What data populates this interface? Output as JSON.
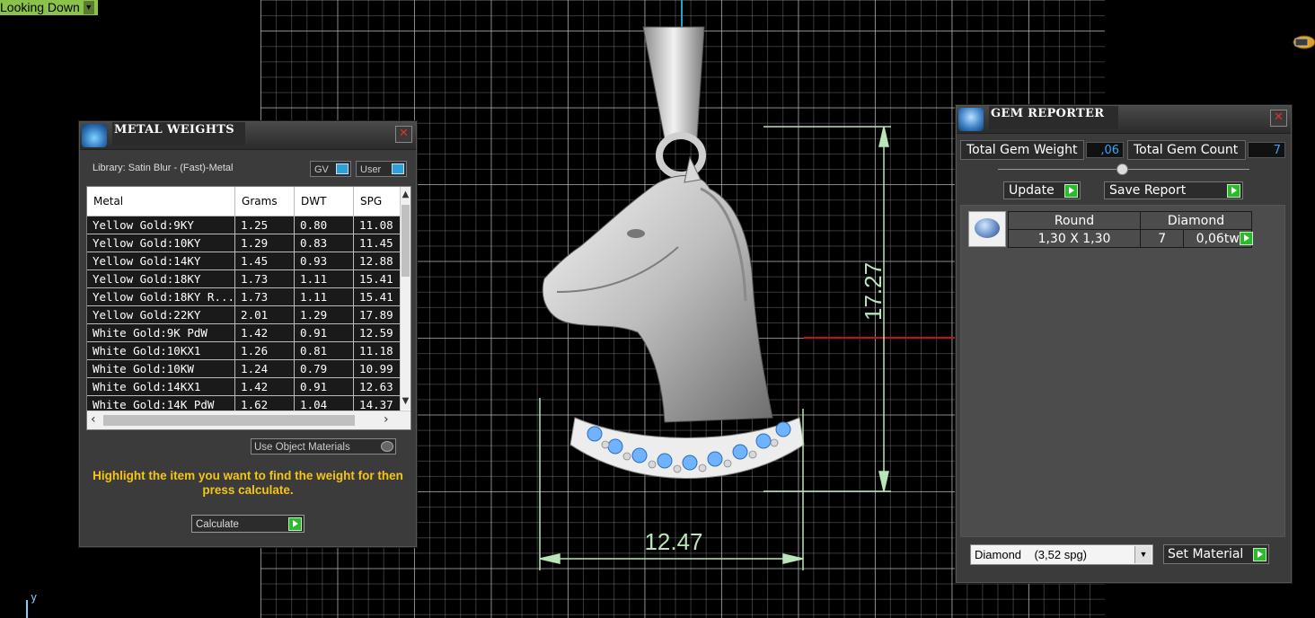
{
  "viewport": {
    "view_name": "Looking Down",
    "dimension_height": "17.27",
    "dimension_width": "12.47",
    "axis_label": "y",
    "colors": {
      "grid": "#808080",
      "dimension": "#b8e6b8",
      "x_axis": "#c0141a",
      "y_axis": "#1aa7c8"
    }
  },
  "metal_panel": {
    "title": "METAL WEIGHTS",
    "library": "Library: Satin Blur - (Fast)-Metal",
    "toggle_gv": "GV",
    "toggle_user": "User",
    "columns": [
      "Metal",
      "Grams",
      "DWT",
      "SPG"
    ],
    "rows": [
      [
        "Yellow Gold:9KY",
        "1.25",
        "0.80",
        "11.08"
      ],
      [
        "Yellow Gold:10KY",
        "1.29",
        "0.83",
        "11.45"
      ],
      [
        "Yellow Gold:14KY",
        "1.45",
        "0.93",
        "12.88"
      ],
      [
        "Yellow Gold:18KY",
        "1.73",
        "1.11",
        "15.41"
      ],
      [
        "Yellow Gold:18KY R...",
        "1.73",
        "1.11",
        "15.41"
      ],
      [
        "Yellow Gold:22KY",
        "2.01",
        "1.29",
        "17.89"
      ],
      [
        "White Gold:9K PdW",
        "1.42",
        "0.91",
        "12.59"
      ],
      [
        "White Gold:10KX1",
        "1.26",
        "0.81",
        "11.18"
      ],
      [
        "White Gold:10KW",
        "1.24",
        "0.79",
        "10.99"
      ],
      [
        "White Gold:14KX1",
        "1.42",
        "0.91",
        "12.63"
      ],
      [
        "White Gold:14K PdW",
        "1.62",
        "1.04",
        "14.37"
      ]
    ],
    "use_object_materials": "Use Object Materials",
    "hint": "Highlight the item you want to find the weight for then press calculate.",
    "calculate_label": "Calculate"
  },
  "gem_panel": {
    "title": "GEM REPORTER",
    "total_weight_label": "Total Gem Weight",
    "total_weight_value": ",06",
    "total_count_label": "Total Gem Count",
    "total_count_value": "7",
    "update_label": "Update",
    "save_report_label": "Save Report",
    "gem_shape": "Round",
    "gem_type": "Diamond",
    "gem_size": "1,30 X 1,30",
    "gem_count": "7",
    "gem_weight": "0,06tw",
    "material_select": "Diamond    (3,52 spg)",
    "set_material_label": "Set Material"
  }
}
